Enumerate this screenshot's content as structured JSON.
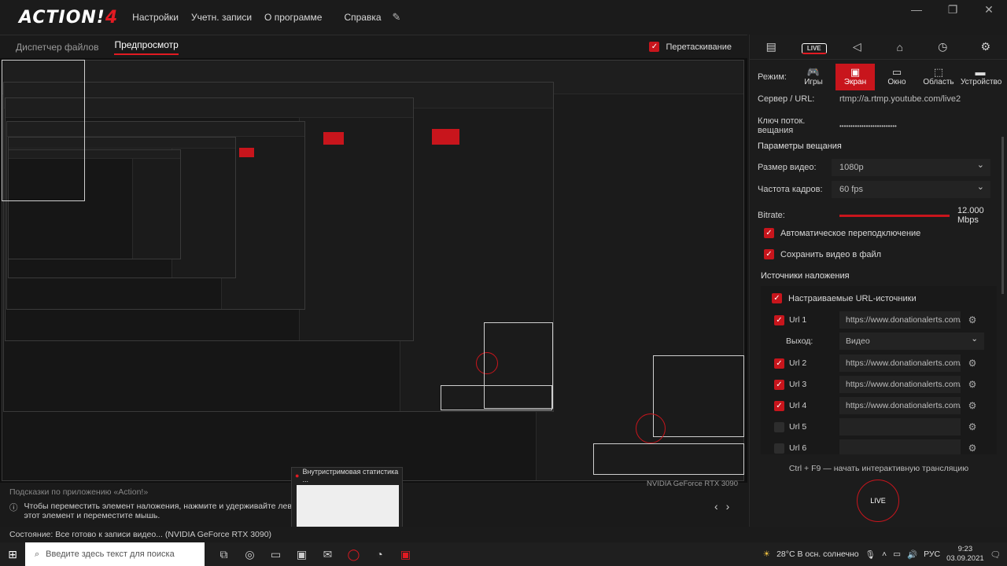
{
  "app": {
    "logo_main": "ACTION!",
    "logo_num": "4",
    "menu": [
      "Настройки",
      "Учетн. записи",
      "О программе",
      "Справка"
    ],
    "window_controls": [
      "—",
      "❐",
      "✕"
    ]
  },
  "tabs": {
    "dispatcher": "Диспетчер файлов",
    "preview": "Предпросмотр",
    "drag_label": "Перетаскивание"
  },
  "right_panel": {
    "top_icons": [
      "film-icon",
      "live-icon",
      "speaker-icon",
      "camera-icon",
      "timer-icon",
      "gear-icon"
    ],
    "live_icon_text": "LIVE",
    "mode_label": "Режим:",
    "modes": [
      {
        "label": "Игры",
        "glyph": "🎮",
        "active": false
      },
      {
        "label": "Экран",
        "glyph": "▣",
        "active": true
      },
      {
        "label": "Окно",
        "glyph": "▭",
        "active": false
      },
      {
        "label": "Область",
        "glyph": "⬚",
        "active": false
      },
      {
        "label": "Устройство",
        "glyph": "▬",
        "active": false
      }
    ],
    "server_label": "Сервер / URL:",
    "server_value": "rtmp://a.rtmp.youtube.com/live2",
    "key_label": "Ключ поток. вещания",
    "key_value": "••••••••••••••••••••••••••",
    "params_title": "Параметры вещания",
    "video_size_label": "Размер видео:",
    "video_size_value": "1080p",
    "fps_label": "Частота кадров:",
    "fps_value": "60 fps",
    "bitrate_label": "Bitrate:",
    "bitrate_value": "12.000 Mbps",
    "auto_reconnect": "Автоматическое переподключение",
    "save_to_file": "Сохранить видео в файл",
    "overlays_title": "Источники наложения",
    "custom_urls": "Настраиваемые URL-источники",
    "url_rows": [
      {
        "name": "Url 1",
        "url": "https://www.donationalerts.com/widge...",
        "checked": true
      },
      {
        "name": "Url 2",
        "url": "https://www.donationalerts.com/widge...",
        "checked": true
      },
      {
        "name": "Url 3",
        "url": "https://www.donationalerts.com/widge...",
        "checked": true
      },
      {
        "name": "Url 4",
        "url": "https://www.donationalerts.com/widge...",
        "checked": true
      },
      {
        "name": "Url 5",
        "url": "",
        "checked": false
      },
      {
        "name": "Url 6",
        "url": "",
        "checked": false
      }
    ],
    "output_label": "Выход:",
    "output_value": "Видео",
    "hint": "Ctrl + F9 — начать интерактивную трансляцию",
    "live_button": "LIVE"
  },
  "preview_footer": {
    "gpu": "NVIDIA GeForce RTX 3090",
    "hints_title": "Подсказки по приложению «Action!»",
    "hint_text": "Чтобы переместить элемент наложения, нажмите и удерживайте левой кнопкой мыши этот элемент и переместите мышь.",
    "status": "Состояние:  Все готово к записи видео...  (NVIDIA GeForce RTX 3090)",
    "stat_window_title": "Внутристримовая статистика ..."
  },
  "taskbar": {
    "search_placeholder": "Введите здесь текст для поиска",
    "weather": "28°C  В осн. солнечно",
    "lang": "РУС",
    "time": "9:23",
    "date": "03.09.2021"
  },
  "colors": {
    "accent": "#c8151c",
    "bg": "#1a1a1a"
  }
}
